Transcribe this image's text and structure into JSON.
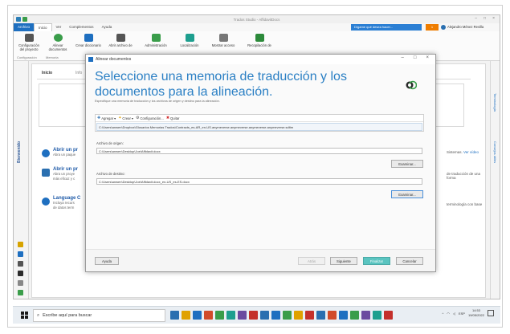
{
  "window": {
    "title": "Trados Studio - AffidavitDocs",
    "controls": [
      "–",
      "□",
      "×"
    ]
  },
  "menu": {
    "items": [
      "Archivo",
      "Inicio",
      "Ver",
      "Complementos",
      "Ayuda"
    ],
    "tell_me": "Dígame qué desea hacer...",
    "badge": "1",
    "user": "Alejandro Ménez Revilla"
  },
  "ribbon": {
    "buttons": [
      {
        "label": "Configuración del proyecto",
        "icon": "project-settings-icon",
        "color": "#555555"
      },
      {
        "label": "Alinear documentos",
        "icon": "align-documents-icon",
        "color": "#3a9d4a"
      },
      {
        "label": "Crear diccionario",
        "icon": "dictionary-icon",
        "color": "#1e6fc0"
      },
      {
        "label": "Abrir archivo de",
        "icon": "open-file-icon",
        "color": "#555555"
      },
      {
        "label": "Administración",
        "icon": "admin-icon",
        "color": "#3a9d4a"
      },
      {
        "label": "Localización",
        "icon": "localization-icon",
        "color": "#1e9f8f"
      },
      {
        "label": "Mostrar acceso",
        "icon": "show-access-icon",
        "color": "#777777"
      },
      {
        "label": "Recopilación de",
        "icon": "collection-icon",
        "color": "#2c8a3a"
      }
    ],
    "group_labels": [
      "Configuración",
      "Memoria"
    ]
  },
  "sidebar": {
    "title": "Bienvenido"
  },
  "rightbar": {
    "labels": [
      "Terminología",
      "Consejos útiles"
    ]
  },
  "content": {
    "tabs": [
      "Inicio",
      "Info"
    ],
    "items": [
      {
        "title": "Abrir un pr",
        "desc": "Abra un paque"
      },
      {
        "title": "Abrir un pr",
        "desc": "Abra un proye",
        "desc2": "más eficaz y c"
      },
      {
        "title": "Language C",
        "desc": "Incluya recurs",
        "desc2": "de datos term"
      }
    ],
    "right_texts": [
      {
        "text": "Sistemas.",
        "link": "Ver vídeo"
      },
      {
        "text": "de traducción de una forma"
      },
      {
        "text": "terminología con base"
      }
    ]
  },
  "dialog": {
    "title": "Alinear documentos",
    "heading": "Seleccione una memoria de traducción y los documentos para la alineación.",
    "subtitle": "Especifique una memoria de traducción y los archivos de origen y destino para la alineación.",
    "toolbar": {
      "add": "Agregar",
      "create": "Crear",
      "config": "Configuración...",
      "remove": "Quitar"
    },
    "tm_path": "C:\\Users\\anwen\\Dropbox\\Glosarios Memorias Trados\\Contracts_es-AR_en-US.anymeverse.anymeverse.anymeverse.anymeverse.sdltm",
    "source_label": "Archivo de origen:",
    "source_value": "C:\\Users\\anwen\\Desktop\\Joe\\Affidavit.docx",
    "target_label": "Archivo de destino:",
    "target_value": "C:\\Users\\anwen\\Desktop\\Joe\\Affidavit.docx_en-US_es-ES.docx",
    "browse": "Examinar...",
    "footer": {
      "help": "Ayuda",
      "back": "Atrás",
      "next": "Siguiente",
      "finish": "Finalizar",
      "cancel": "Cancelar"
    }
  },
  "taskbar": {
    "search_placeholder": "Escribe aquí para buscar",
    "apps": [
      "#2a6fb0",
      "#e0a100",
      "#1e6fc0",
      "#d14b2a",
      "#3a9d4a",
      "#1e9f8f",
      "#6b4aa0",
      "#c4302b",
      "#2a6fb0",
      "#1e6fc0",
      "#3a9d4a",
      "#e0a100",
      "#c4302b",
      "#2a6fb0",
      "#d14b2a",
      "#1e6fc0",
      "#3a9d4a",
      "#6b4aa0",
      "#1e9f8f",
      "#c4302b"
    ],
    "lang": "ESP",
    "time": "14:53",
    "date": "19/05/2022"
  }
}
